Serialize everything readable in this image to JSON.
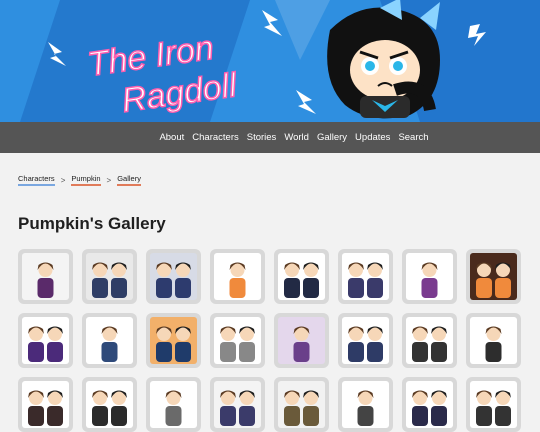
{
  "site": {
    "logo_text_line1": "The Iron",
    "logo_text_line2": "Ragdoll"
  },
  "nav": {
    "items": [
      "About",
      "Characters",
      "Stories",
      "World",
      "Gallery",
      "Updates",
      "Search"
    ]
  },
  "breadcrumb": {
    "items": [
      "Characters",
      "Pumpkin",
      "Gallery"
    ],
    "separator": ">"
  },
  "page": {
    "title": "Pumpkin's Gallery"
  },
  "thumbnails": [
    {
      "name": "thumb-1",
      "bg": "#f4f4f4",
      "accent": "#5a2a6a"
    },
    {
      "name": "thumb-2",
      "bg": "#e9e9e9",
      "accent": "#2f3e66"
    },
    {
      "name": "thumb-3",
      "bg": "#d7dbe6",
      "accent": "#2d3b6e"
    },
    {
      "name": "thumb-4",
      "bg": "#ffffff",
      "accent": "#f08a3c"
    },
    {
      "name": "thumb-5",
      "bg": "#ffffff",
      "accent": "#222a44"
    },
    {
      "name": "thumb-6",
      "bg": "#ffffff",
      "accent": "#3a3a6a"
    },
    {
      "name": "thumb-7",
      "bg": "#ffffff",
      "accent": "#7a3b8f"
    },
    {
      "name": "thumb-8",
      "bg": "#4a2a1c",
      "accent": "#f08a3c"
    },
    {
      "name": "thumb-9",
      "bg": "#ffffff",
      "accent": "#4b2a7a"
    },
    {
      "name": "thumb-10",
      "bg": "#ffffff",
      "accent": "#2f4a7a"
    },
    {
      "name": "thumb-11",
      "bg": "#f2b06a",
      "accent": "#1f3b6a"
    },
    {
      "name": "thumb-12",
      "bg": "#ffffff",
      "accent": "#888888"
    },
    {
      "name": "thumb-13",
      "bg": "#e4d7ec",
      "accent": "#6a3f8a"
    },
    {
      "name": "thumb-14",
      "bg": "#ffffff",
      "accent": "#2e3b66"
    },
    {
      "name": "thumb-15",
      "bg": "#ffffff",
      "accent": "#333333"
    },
    {
      "name": "thumb-16",
      "bg": "#ffffff",
      "accent": "#2d2d2d"
    },
    {
      "name": "thumb-17",
      "bg": "#ffffff",
      "accent": "#3a2a2a"
    },
    {
      "name": "thumb-18",
      "bg": "#ffffff",
      "accent": "#2b2b2b"
    },
    {
      "name": "thumb-19",
      "bg": "#ffffff",
      "accent": "#6a6a6a"
    },
    {
      "name": "thumb-20",
      "bg": "#f4f4f4",
      "accent": "#3b3b6a"
    },
    {
      "name": "thumb-21",
      "bg": "#f2f2f2",
      "accent": "#6a5a3a"
    },
    {
      "name": "thumb-22",
      "bg": "#ffffff",
      "accent": "#444444"
    },
    {
      "name": "thumb-23",
      "bg": "#ffffff",
      "accent": "#2a2a4a"
    },
    {
      "name": "thumb-24",
      "bg": "#ffffff",
      "accent": "#333333"
    }
  ],
  "colors": {
    "banner_blue": "#2f8fe0",
    "nav_bg": "#555555",
    "link_underline": "#e07b5a"
  }
}
